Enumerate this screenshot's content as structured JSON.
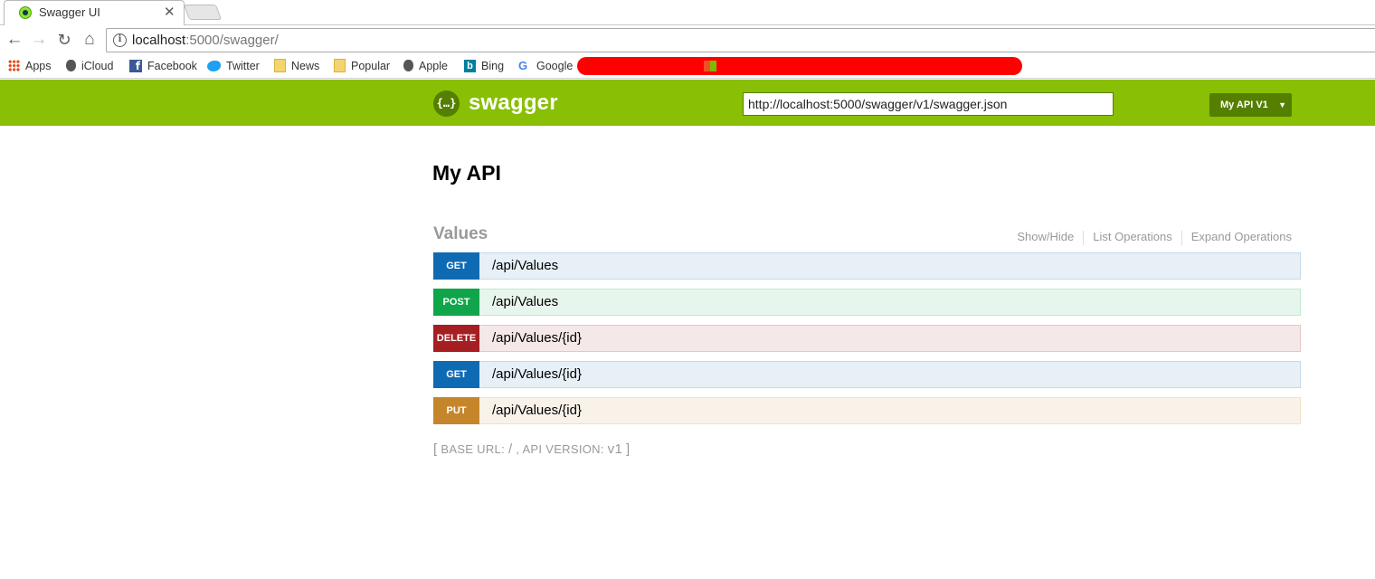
{
  "browser": {
    "tab_title": "Swagger UI",
    "tab_close": "✕",
    "url_host": "localhost",
    "url_rest": ":5000/swagger/",
    "nav": {
      "back": "←",
      "forward": "→",
      "reload": "↻",
      "home": "⌂",
      "info": "i"
    },
    "bookmarks": [
      {
        "label": "Apps",
        "icon": "apps-icon"
      },
      {
        "label": "iCloud",
        "icon": "apple-icon"
      },
      {
        "label": "Facebook",
        "icon": "facebook-icon"
      },
      {
        "label": "Twitter",
        "icon": "twitter-icon"
      },
      {
        "label": "News",
        "icon": "folder-icon"
      },
      {
        "label": "Popular",
        "icon": "folder-icon"
      },
      {
        "label": "Apple",
        "icon": "apple-icon"
      },
      {
        "label": "Bing",
        "icon": "bing-icon"
      },
      {
        "label": "Google",
        "icon": "google-icon"
      }
    ]
  },
  "header": {
    "logo_symbol": "{…}",
    "logo_text": "swagger",
    "spec_url": "http://localhost:5000/swagger/v1/swagger.json",
    "api_select": "My API V1",
    "select_arrow": "▼",
    "brand_color": "#89bf04"
  },
  "main": {
    "title": "My API",
    "resource": {
      "name": "Values",
      "links": [
        "Show/Hide",
        "List Operations",
        "Expand Operations"
      ]
    },
    "operations": [
      {
        "method": "GET",
        "path": "/api/Values"
      },
      {
        "method": "POST",
        "path": "/api/Values"
      },
      {
        "method": "DELETE",
        "path": "/api/Values/{id}"
      },
      {
        "method": "GET",
        "path": "/api/Values/{id}"
      },
      {
        "method": "PUT",
        "path": "/api/Values/{id}"
      }
    ],
    "footer": {
      "open": "[",
      "base_url_label": "BASE URL:",
      "base_url": "/",
      "sep": ",",
      "version_label": "API VERSION:",
      "version": "v1",
      "close": "]"
    }
  }
}
